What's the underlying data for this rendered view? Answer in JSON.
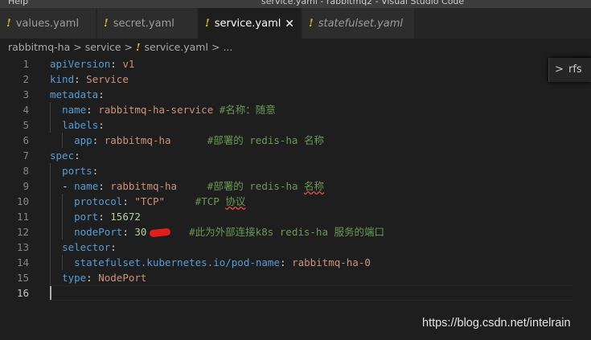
{
  "titlebar": {
    "menu_label": "Help",
    "window_title": "service.yaml - rabbitmq2 - Visual Studio Code"
  },
  "tabs": [
    {
      "label": "values.yaml",
      "modified_icon": "!",
      "active": false
    },
    {
      "label": "secret.yaml",
      "modified_icon": "!",
      "active": false
    },
    {
      "label": "service.yaml",
      "modified_icon": "!",
      "active": true,
      "close": "✕"
    },
    {
      "label": "statefulset.yaml",
      "modified_icon": "!",
      "active": false
    }
  ],
  "breadcrumb": {
    "items": [
      "rabbitmq-ha",
      "service",
      "service.yaml",
      "..."
    ],
    "separator": ">",
    "file_icon": "!"
  },
  "editor": {
    "line_numbers": [
      "1",
      "2",
      "3",
      "4",
      "5",
      "6",
      "7",
      "8",
      "9",
      "10",
      "11",
      "12",
      "13",
      "14",
      "15",
      "16"
    ],
    "colors": {
      "key": "#569cd6",
      "string": "#ce9178",
      "number": "#b5cea8",
      "comment": "#6a9955"
    },
    "lines": {
      "l1": {
        "k": "apiVersion",
        "colon": ": ",
        "v": "v1"
      },
      "l2": {
        "k": "kind",
        "colon": ": ",
        "v": "Service"
      },
      "l3": {
        "k": "metadata",
        "colon": ":"
      },
      "l4": {
        "indent": "  ",
        "k": "name",
        "colon": ": ",
        "v": "rabbitmq-ha-service",
        "sp": " ",
        "c": "#名称：随意"
      },
      "l5": {
        "indent": "  ",
        "k": "labels",
        "colon": ":"
      },
      "l6": {
        "indent": "    ",
        "k": "app",
        "colon": ": ",
        "v": "rabbitmq-ha",
        "sp": "      ",
        "c": "#部署的 redis-ha 名称"
      },
      "l7": {
        "k": "spec",
        "colon": ":"
      },
      "l8": {
        "indent": "  ",
        "k": "ports",
        "colon": ":"
      },
      "l9": {
        "indent": "  ",
        "dash": "- ",
        "k": "name",
        "colon": ": ",
        "v": "rabbitmq-ha",
        "sp": "     ",
        "c1": "#部署的 redis-ha ",
        "c2": "名称"
      },
      "l10": {
        "indent": "    ",
        "k": "protocol",
        "colon": ": ",
        "v": "\"TCP\"",
        "sp": "     ",
        "c1": "#TCP ",
        "c2": "协议"
      },
      "l11": {
        "indent": "    ",
        "k": "port",
        "colon": ": ",
        "v": "15672"
      },
      "l12": {
        "indent": "    ",
        "k": "nodePort",
        "colon": ": ",
        "v": "30",
        "sp": "       ",
        "c": "#此为外部连接k8s redis-ha 服务的端口"
      },
      "l13": {
        "indent": "  ",
        "k": "selector",
        "colon": ":"
      },
      "l14": {
        "indent": "    ",
        "k": "statefulset.kubernetes.io/pod-name",
        "colon": ": ",
        "v": "rabbitmq-ha-0"
      },
      "l15": {
        "indent": "  ",
        "k": "type",
        "colon": ": ",
        "v": "NodePort"
      },
      "l16": {}
    }
  },
  "peek_widget": {
    "chevron": ">",
    "label": "rfs"
  },
  "watermark": "https://blog.csdn.net/intelrain"
}
